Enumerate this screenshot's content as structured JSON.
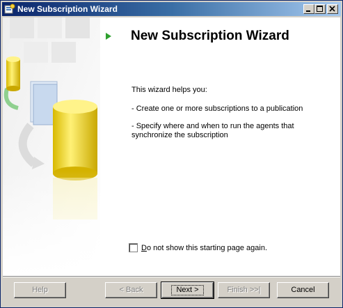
{
  "window": {
    "title": "New Subscription Wizard",
    "icons": [
      "app-icon",
      "minimize-icon",
      "maximize-icon",
      "close-icon"
    ]
  },
  "page": {
    "heading": "New Subscription Wizard",
    "intro": "This wizard helps you:",
    "bullets": [
      "- Create one or more subscriptions to a publication",
      "- Specify where and when to run the agents that synchronize the subscription"
    ],
    "checkbox": {
      "label": "Do not show this starting page again.",
      "checked": false
    }
  },
  "buttons": {
    "help": "Help",
    "back": "< Back",
    "next": "Next >",
    "finish": "Finish >>|",
    "cancel": "Cancel"
  },
  "colors": {
    "titlebar_start": "#0a246a",
    "titlebar_end": "#a6caf0",
    "arrow": "#2ea02e"
  }
}
